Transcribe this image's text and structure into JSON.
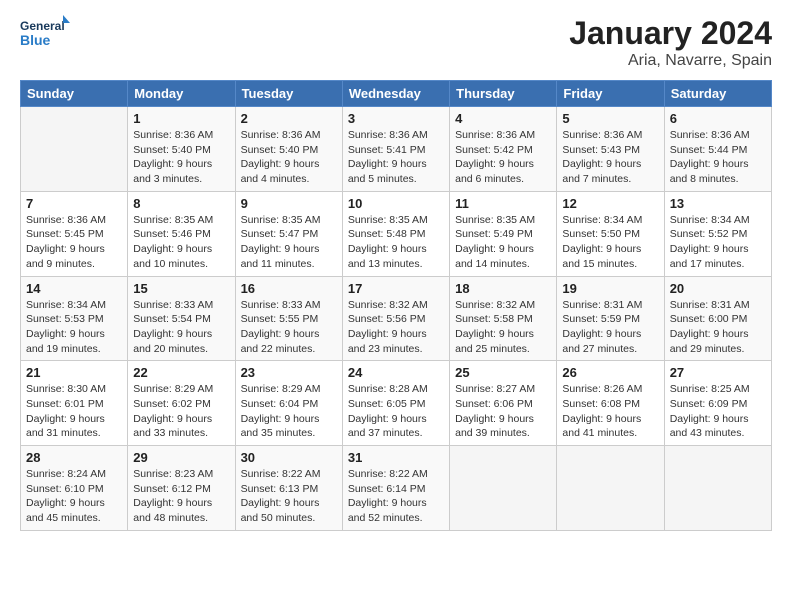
{
  "header": {
    "logo_line1": "General",
    "logo_line2": "Blue",
    "title": "January 2024",
    "subtitle": "Aria, Navarre, Spain"
  },
  "weekdays": [
    "Sunday",
    "Monday",
    "Tuesday",
    "Wednesday",
    "Thursday",
    "Friday",
    "Saturday"
  ],
  "weeks": [
    [
      {
        "day": "",
        "info": ""
      },
      {
        "day": "1",
        "info": "Sunrise: 8:36 AM\nSunset: 5:40 PM\nDaylight: 9 hours\nand 3 minutes."
      },
      {
        "day": "2",
        "info": "Sunrise: 8:36 AM\nSunset: 5:40 PM\nDaylight: 9 hours\nand 4 minutes."
      },
      {
        "day": "3",
        "info": "Sunrise: 8:36 AM\nSunset: 5:41 PM\nDaylight: 9 hours\nand 5 minutes."
      },
      {
        "day": "4",
        "info": "Sunrise: 8:36 AM\nSunset: 5:42 PM\nDaylight: 9 hours\nand 6 minutes."
      },
      {
        "day": "5",
        "info": "Sunrise: 8:36 AM\nSunset: 5:43 PM\nDaylight: 9 hours\nand 7 minutes."
      },
      {
        "day": "6",
        "info": "Sunrise: 8:36 AM\nSunset: 5:44 PM\nDaylight: 9 hours\nand 8 minutes."
      }
    ],
    [
      {
        "day": "7",
        "info": "Sunrise: 8:36 AM\nSunset: 5:45 PM\nDaylight: 9 hours\nand 9 minutes."
      },
      {
        "day": "8",
        "info": "Sunrise: 8:35 AM\nSunset: 5:46 PM\nDaylight: 9 hours\nand 10 minutes."
      },
      {
        "day": "9",
        "info": "Sunrise: 8:35 AM\nSunset: 5:47 PM\nDaylight: 9 hours\nand 11 minutes."
      },
      {
        "day": "10",
        "info": "Sunrise: 8:35 AM\nSunset: 5:48 PM\nDaylight: 9 hours\nand 13 minutes."
      },
      {
        "day": "11",
        "info": "Sunrise: 8:35 AM\nSunset: 5:49 PM\nDaylight: 9 hours\nand 14 minutes."
      },
      {
        "day": "12",
        "info": "Sunrise: 8:34 AM\nSunset: 5:50 PM\nDaylight: 9 hours\nand 15 minutes."
      },
      {
        "day": "13",
        "info": "Sunrise: 8:34 AM\nSunset: 5:52 PM\nDaylight: 9 hours\nand 17 minutes."
      }
    ],
    [
      {
        "day": "14",
        "info": "Sunrise: 8:34 AM\nSunset: 5:53 PM\nDaylight: 9 hours\nand 19 minutes."
      },
      {
        "day": "15",
        "info": "Sunrise: 8:33 AM\nSunset: 5:54 PM\nDaylight: 9 hours\nand 20 minutes."
      },
      {
        "day": "16",
        "info": "Sunrise: 8:33 AM\nSunset: 5:55 PM\nDaylight: 9 hours\nand 22 minutes."
      },
      {
        "day": "17",
        "info": "Sunrise: 8:32 AM\nSunset: 5:56 PM\nDaylight: 9 hours\nand 23 minutes."
      },
      {
        "day": "18",
        "info": "Sunrise: 8:32 AM\nSunset: 5:58 PM\nDaylight: 9 hours\nand 25 minutes."
      },
      {
        "day": "19",
        "info": "Sunrise: 8:31 AM\nSunset: 5:59 PM\nDaylight: 9 hours\nand 27 minutes."
      },
      {
        "day": "20",
        "info": "Sunrise: 8:31 AM\nSunset: 6:00 PM\nDaylight: 9 hours\nand 29 minutes."
      }
    ],
    [
      {
        "day": "21",
        "info": "Sunrise: 8:30 AM\nSunset: 6:01 PM\nDaylight: 9 hours\nand 31 minutes."
      },
      {
        "day": "22",
        "info": "Sunrise: 8:29 AM\nSunset: 6:02 PM\nDaylight: 9 hours\nand 33 minutes."
      },
      {
        "day": "23",
        "info": "Sunrise: 8:29 AM\nSunset: 6:04 PM\nDaylight: 9 hours\nand 35 minutes."
      },
      {
        "day": "24",
        "info": "Sunrise: 8:28 AM\nSunset: 6:05 PM\nDaylight: 9 hours\nand 37 minutes."
      },
      {
        "day": "25",
        "info": "Sunrise: 8:27 AM\nSunset: 6:06 PM\nDaylight: 9 hours\nand 39 minutes."
      },
      {
        "day": "26",
        "info": "Sunrise: 8:26 AM\nSunset: 6:08 PM\nDaylight: 9 hours\nand 41 minutes."
      },
      {
        "day": "27",
        "info": "Sunrise: 8:25 AM\nSunset: 6:09 PM\nDaylight: 9 hours\nand 43 minutes."
      }
    ],
    [
      {
        "day": "28",
        "info": "Sunrise: 8:24 AM\nSunset: 6:10 PM\nDaylight: 9 hours\nand 45 minutes."
      },
      {
        "day": "29",
        "info": "Sunrise: 8:23 AM\nSunset: 6:12 PM\nDaylight: 9 hours\nand 48 minutes."
      },
      {
        "day": "30",
        "info": "Sunrise: 8:22 AM\nSunset: 6:13 PM\nDaylight: 9 hours\nand 50 minutes."
      },
      {
        "day": "31",
        "info": "Sunrise: 8:22 AM\nSunset: 6:14 PM\nDaylight: 9 hours\nand 52 minutes."
      },
      {
        "day": "",
        "info": ""
      },
      {
        "day": "",
        "info": ""
      },
      {
        "day": "",
        "info": ""
      }
    ]
  ]
}
